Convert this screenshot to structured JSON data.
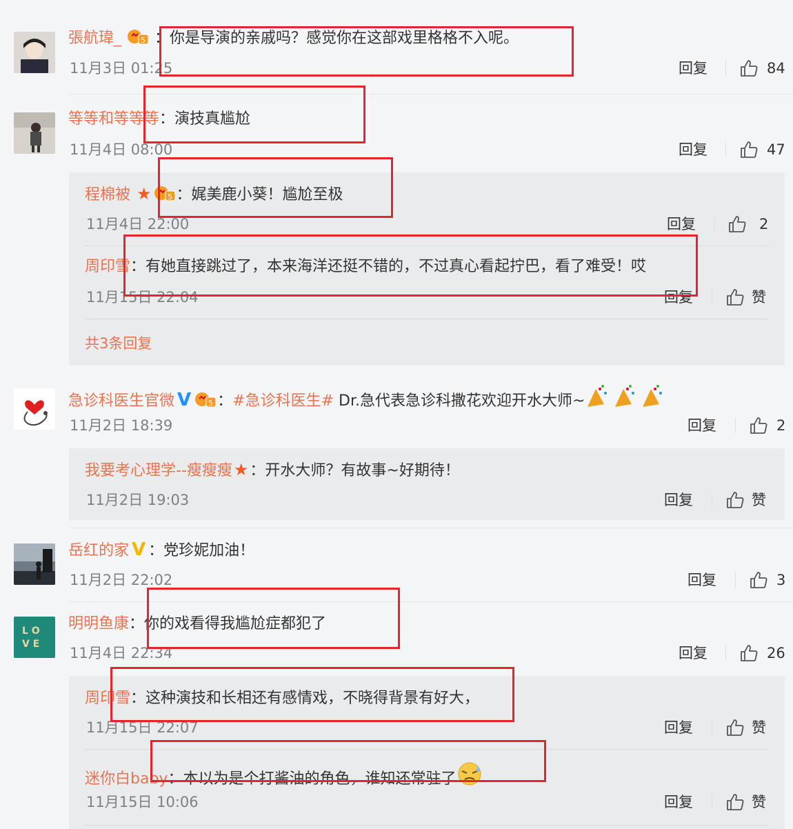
{
  "comments": [
    {
      "username": "張航瑋_",
      "text": "你是导演的亲戚吗？感觉你在这部戏里格格不入呢。",
      "time": "11月3日 01:25",
      "reply_label": "回复",
      "likes": "84"
    },
    {
      "username": "等等和等等等",
      "text": "演技真尴尬",
      "time": "11月4日 08:00",
      "reply_label": "回复",
      "likes": "47",
      "replies": [
        {
          "username": "程棉被",
          "text": "娓美鹿小葵！尴尬至极",
          "time": "11月4日 22:00",
          "reply_label": "回复",
          "likes": "2"
        },
        {
          "username": "周印雪",
          "text": "有她直接跳过了，本来海洋还挺不错的，不过真心看起拧巴，看了难受！哎",
          "time": "11月15日 22:04",
          "reply_label": "回复",
          "likes": "赞"
        }
      ],
      "more_replies": "共3条回复"
    },
    {
      "username": "急诊科医生官微",
      "topic": "#急诊科医生#",
      "text": "Dr.急代表急诊科撒花欢迎开水大师~",
      "time": "11月2日 18:39",
      "reply_label": "回复",
      "likes": "2",
      "replies": [
        {
          "username": "我要考心理学--瘦瘦瘦",
          "text": "开水大师？有故事~好期待！",
          "time": "11月2日 19:03",
          "reply_label": "回复",
          "likes": "赞"
        }
      ]
    },
    {
      "username": "岳红的家",
      "text": "党珍妮加油！",
      "time": "11月2日 22:02",
      "reply_label": "回复",
      "likes": "3"
    },
    {
      "username": "明明鱼康",
      "text": "你的戏看得我尴尬症都犯了",
      "time": "11月4日 22:34",
      "reply_label": "回复",
      "likes": "26",
      "replies": [
        {
          "username": "周印雪",
          "text": "这种演技和长相还有感情戏，不晓得背景有好大，",
          "time": "11月15日 22:07",
          "reply_label": "回复",
          "likes": "赞"
        },
        {
          "username": "迷你白baby",
          "text": "本以为是个打酱油的角色，谁知还常驻了",
          "time": "11月15日 10:06",
          "reply_label": "回复",
          "likes": "赞"
        }
      ]
    }
  ],
  "avatar_text": "LOVE",
  "colors": {
    "username": "#eb7350",
    "highlight_box": "#e5252d",
    "verified_blue": "#1e90ff",
    "verified_gold": "#f7b500"
  }
}
